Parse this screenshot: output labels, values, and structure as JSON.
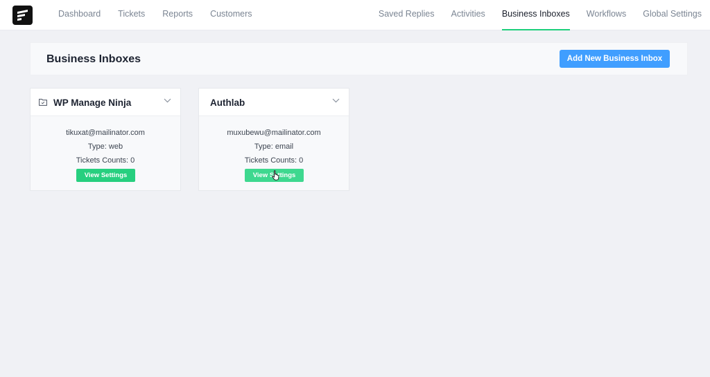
{
  "nav": {
    "left": [
      "Dashboard",
      "Tickets",
      "Reports",
      "Customers"
    ],
    "right": [
      "Saved Replies",
      "Activities",
      "Business Inboxes",
      "Workflows",
      "Global Settings"
    ],
    "active": "Business Inboxes"
  },
  "page": {
    "title": "Business Inboxes",
    "add_button": "Add New Business Inbox"
  },
  "inboxes": [
    {
      "name": "WP Manage Ninja",
      "email": "tikuxat@mailinator.com",
      "type": "Type: web",
      "tickets": "Tickets Counts: 0",
      "button": "View Settings"
    },
    {
      "name": "Authlab",
      "email": "muxubewu@mailinator.com",
      "type": "Type: email",
      "tickets": "Tickets Counts: 0",
      "button": "View Settings"
    }
  ],
  "colors": {
    "accent_blue": "#409eff",
    "accent_green": "#27cf7f",
    "active_underline": "#1ccf7b"
  },
  "icons": {
    "logo": "fluent-support-logo",
    "folder": "folder-icon",
    "chevron": "chevron-down-icon",
    "cursor": "hand-pointer-icon"
  }
}
